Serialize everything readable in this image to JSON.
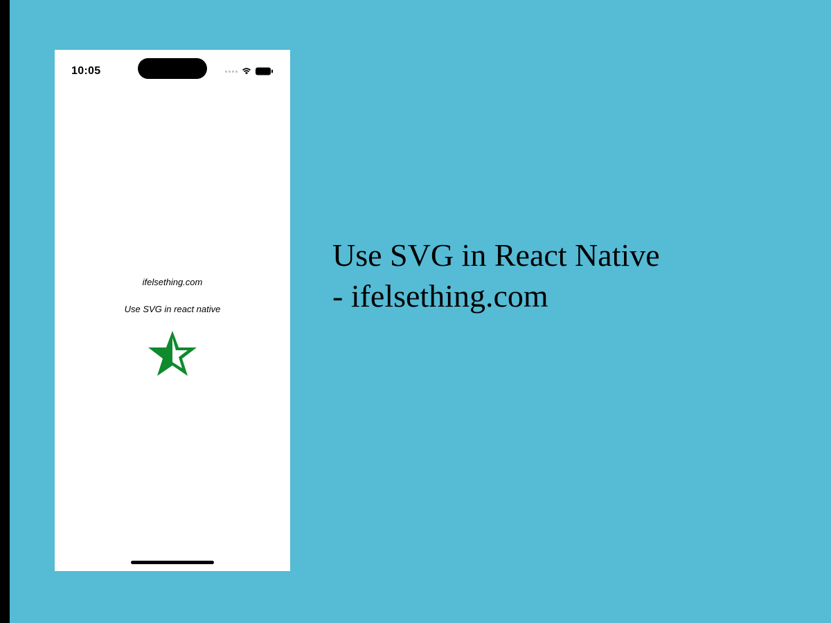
{
  "colors": {
    "canvas_bg": "#56bbd5",
    "star_fill": "#0f8a2d"
  },
  "phone": {
    "status": {
      "time": "10:05"
    },
    "content": {
      "site_label": "ifelsething.com",
      "app_title": "Use SVG in react native"
    }
  },
  "headline": {
    "line1": "Use SVG in React Native",
    "line2": "- ifelsething.com"
  }
}
